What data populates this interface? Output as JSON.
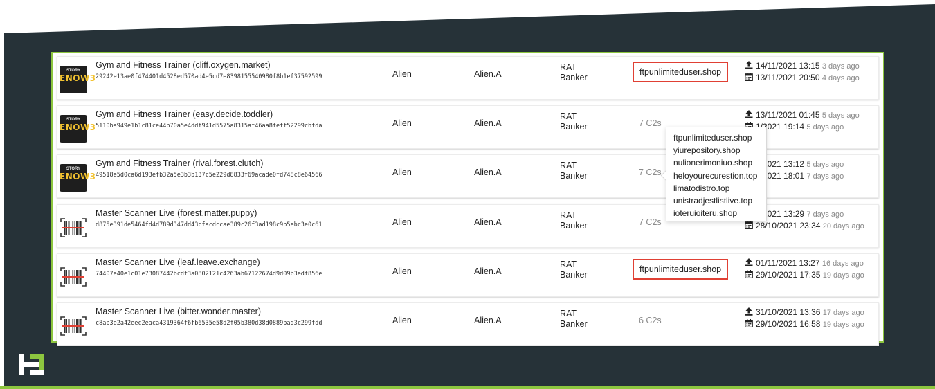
{
  "colors": {
    "background": "#263238",
    "accent_green": "#8dc63f",
    "highlight_red": "#e04034",
    "muted_text": "#8a8a8a"
  },
  "icons": {
    "upload": "upload-arrow-icon",
    "calendar": "calendar-icon",
    "game_app": "gym-game-app-icon",
    "scanner_app": "barcode-scanner-app-icon",
    "brand_logo": "brand-logo-icon"
  },
  "game_icon_text": {
    "top": "STORY",
    "middle": "ENOW3",
    "bottom": ""
  },
  "rows": [
    {
      "name": "Gym and Fitness Trainer (cliff.oxygen.market)",
      "hash": "29242e13ae0f474401d4528ed570ad4e5cd7e8398155540980f8b1ef37592599",
      "family": "Alien",
      "variant": "Alien.A",
      "type_line1": "RAT",
      "type_line2": "Banker",
      "c2": "ftpunlimiteduser.shop",
      "c2_highlighted": true,
      "uploaded": "14/11/2021 13:15",
      "uploaded_ago": "3 days ago",
      "first_seen": "13/11/2021 20:50",
      "first_seen_ago": "4 days ago"
    },
    {
      "name": "Gym and Fitness Trainer (easy.decide.toddler)",
      "hash": "5110ba949e1b1c81ce44b70a5e4ddf941d5575a8315af46aa8feff52299cbfda",
      "family": "Alien",
      "variant": "Alien.A",
      "type_line1": "RAT",
      "type_line2": "Banker",
      "c2": "7 C2s",
      "c2_highlighted": false,
      "uploaded": "13/11/2021 01:45",
      "uploaded_ago": "5 days ago",
      "first_seen": "1/2021 19:14",
      "first_seen_ago": "5 days ago"
    },
    {
      "name": "Gym and Fitness Trainer (rival.forest.clutch)",
      "hash": "49518e5d0ca6d193efb32a5e3b3b137c5e229d8833f69acade0fd748c8e64566",
      "family": "Alien",
      "variant": "Alien.A",
      "type_line1": "RAT",
      "type_line2": "Banker",
      "c2": "7 C2s",
      "c2_highlighted": false,
      "uploaded": "1/2021 13:12",
      "uploaded_ago": "5 days ago",
      "first_seen": "1/2021 18:01",
      "first_seen_ago": "7 days ago"
    },
    {
      "name": "Master Scanner Live (forest.matter.puppy)",
      "hash": "d875e391de5464fd4d789d347dd43cfacdccae389c26f3ad198c9b5ebc3e0c61",
      "family": "Alien",
      "variant": "Alien.A",
      "type_line1": "RAT",
      "type_line2": "Banker",
      "c2": "7 C2s",
      "c2_highlighted": false,
      "uploaded": "1/2021 13:29",
      "uploaded_ago": "7 days ago",
      "first_seen": "28/10/2021 23:34",
      "first_seen_ago": "20 days ago"
    },
    {
      "name": "Master Scanner Live (leaf.leave.exchange)",
      "hash": "74407e40e1c01e73087442bcdf3a0802121c4263ab67122674d9d09b3edf856e",
      "family": "Alien",
      "variant": "Alien.A",
      "type_line1": "RAT",
      "type_line2": "Banker",
      "c2": "ftpunlimiteduser.shop",
      "c2_highlighted": true,
      "uploaded": "01/11/2021 13:27",
      "uploaded_ago": "16 days ago",
      "first_seen": "29/10/2021 17:35",
      "first_seen_ago": "19 days ago"
    },
    {
      "name": "Master Scanner Live (bitter.wonder.master)",
      "hash": "c8ab3e2a42eec2eaca4319364f6fb6535e58d2f05b380d38d0889bad3c299fdd",
      "family": "Alien",
      "variant": "Alien.A",
      "type_line1": "RAT",
      "type_line2": "Banker",
      "c2": "6 C2s",
      "c2_highlighted": false,
      "uploaded": "31/10/2021 13:36",
      "uploaded_ago": "17 days ago",
      "first_seen": "29/10/2021 16:58",
      "first_seen_ago": "19 days ago"
    }
  ],
  "c2_popup": {
    "items": [
      "ftpunlimiteduser.shop",
      "yiurepository.shop",
      "nulionerimoniuo.shop",
      "heloyourecurestion.top",
      "limatodistro.top",
      "unistradjestlistlive.top",
      "ioteruioiteru.shop"
    ]
  }
}
